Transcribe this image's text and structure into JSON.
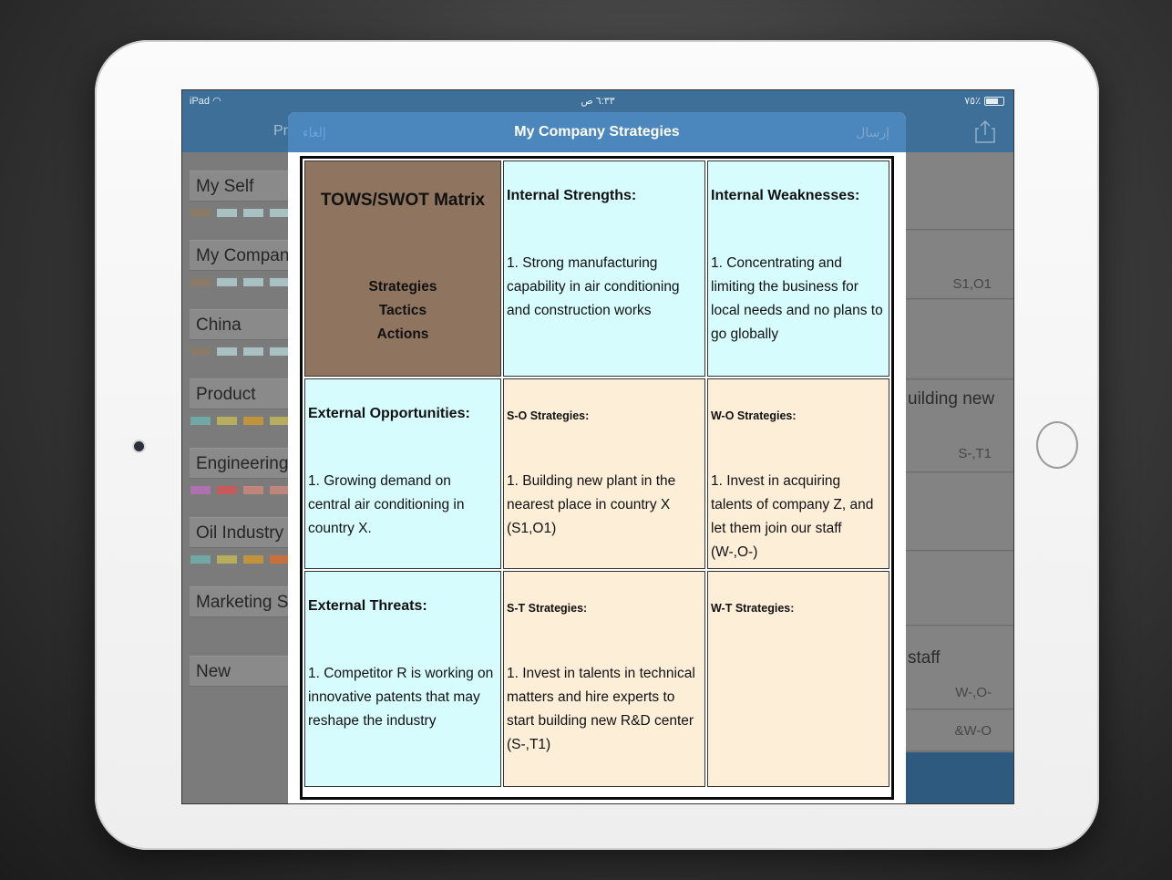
{
  "device": {
    "model": "iPad"
  },
  "status_bar": {
    "carrier": "iPad",
    "time": "٦:٣٣ ص",
    "battery": "٧٥٪"
  },
  "nav": {
    "partial_title": "Pr"
  },
  "sidebar": {
    "items": [
      {
        "label": "My Self",
        "swatches": [
          "#8a7a68",
          "#a9c1c3",
          "#a9c1c3",
          "#a9c1c3"
        ]
      },
      {
        "label": "My Company",
        "swatches": [
          "#8a7a68",
          "#a9c1c3",
          "#a9c1c3",
          "#a9c1c3"
        ]
      },
      {
        "label": "China",
        "swatches": [
          "#8a7a68",
          "#a9c1c3",
          "#a9c1c3",
          "#a9c1c3"
        ]
      },
      {
        "label": "Product",
        "swatches": [
          "#6fa8a4",
          "#b7ad5e",
          "#c0943c",
          "#b7ad5e"
        ]
      },
      {
        "label": "Engineering I",
        "swatches": [
          "#b06fae",
          "#c65a5a",
          "#c0857b",
          "#c0857b"
        ]
      },
      {
        "label": "Oil Industry",
        "swatches": [
          "#6fa8a4",
          "#b7ad5e",
          "#c0943c",
          "#c8703a"
        ]
      },
      {
        "label": "Marketing St",
        "swatches": []
      },
      {
        "label": "New",
        "swatches": []
      }
    ]
  },
  "right_panel": {
    "row1": {
      "text": "",
      "code": "S1,O1"
    },
    "row2": {
      "text": "uilding new",
      "code": "S-,T1"
    },
    "row3": {
      "text": "staff",
      "code": "W-,O-"
    },
    "row4": {
      "text": "",
      "code": "&W-O"
    }
  },
  "modal": {
    "title": "My Company Strategies",
    "cancel_label": "إلغاء",
    "send_label": "إرسال"
  },
  "matrix": {
    "corner": {
      "title": "TOWS/SWOT Matrix",
      "lines": [
        "Strategies",
        "Tactics",
        "Actions"
      ]
    },
    "strengths": {
      "header": "Internal Strengths:",
      "body": "1. Strong manufacturing capability in air conditioning and construction works"
    },
    "weaknesses": {
      "header": "Internal Weaknesses:",
      "body": "1. Concentrating and limiting the business for local needs and no plans to go globally"
    },
    "opportunities": {
      "header": "External Opportunities:",
      "body": "1. Growing demand on central air conditioning in country X."
    },
    "so": {
      "header": "S-O Strategies:",
      "body": "1. Building new plant in the nearest place in country X (S1,O1)"
    },
    "wo": {
      "header": "W-O Strategies:",
      "body": "1. Invest in acquiring talents of company Z, and let them join our staff (W-,O-)"
    },
    "threats": {
      "header": "External Threats:",
      "body": "1. Competitor R is working on innovative patents that may reshape the industry"
    },
    "st": {
      "header": "S-T Strategies:",
      "body": "1. Invest in talents in technical matters and hire experts to start building new R&D center (S-,T1)"
    },
    "wt": {
      "header": "W-T Strategies:",
      "body": ""
    }
  },
  "colors": {
    "nav_blue": "#3d6f99",
    "modal_header_blue": "#4b87bd",
    "cell_cyan": "#d7fcfd",
    "cell_peach": "#fdeed8",
    "corner_brown": "#8f7560"
  }
}
